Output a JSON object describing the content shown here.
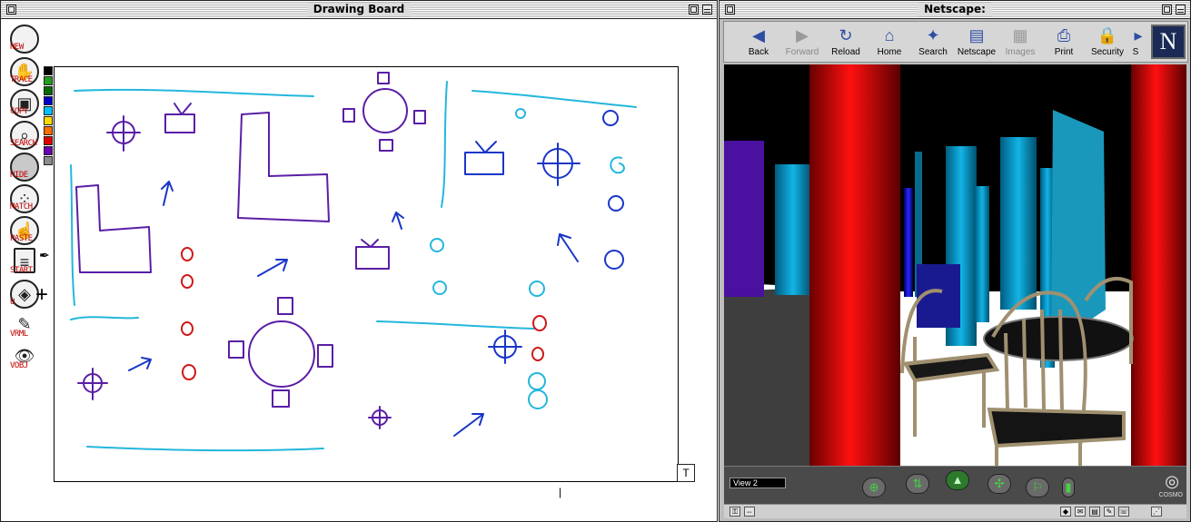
{
  "drawing_window": {
    "title": "Drawing Board",
    "tools": [
      {
        "label": "NEW",
        "icon": "circle-new-icon"
      },
      {
        "label": "TRACE",
        "icon": "cat-paw-icon"
      },
      {
        "label": "COPY",
        "icon": "camera-icon"
      },
      {
        "label": "SEARCH",
        "icon": "magnifier-icon"
      },
      {
        "label": "HIDE",
        "icon": "grey-disc-icon"
      },
      {
        "label": "MATCH",
        "icon": "footprint-icon"
      },
      {
        "label": "PASTE",
        "icon": "hand-icon"
      },
      {
        "label": "START",
        "icon": "page-icon"
      },
      {
        "label": "U",
        "icon": "shapes-icon"
      },
      {
        "label": "VRML",
        "icon": "pencil-icon"
      },
      {
        "label": "VOBJ",
        "icon": "eye-icon"
      }
    ],
    "swatch_colors": [
      "#000000",
      "#1f9e1f",
      "#006b00",
      "#0000cc",
      "#00c0ff",
      "#ffd800",
      "#ff6c00",
      "#e00000",
      "#6b00b0",
      "#8c8c8c"
    ],
    "resize_glyph": "T",
    "ink_colors": {
      "cyan": "#23b7dc",
      "purple": "#5a1ea6",
      "red": "#d01818",
      "blue": "#1a36c8"
    }
  },
  "netscape_window": {
    "title": "Netscape:",
    "toolbar": [
      {
        "label": "Back",
        "icon": "back-arrow-icon",
        "enabled": true
      },
      {
        "label": "Forward",
        "icon": "forward-arrow-icon",
        "enabled": false
      },
      {
        "label": "Reload",
        "icon": "reload-icon",
        "enabled": true
      },
      {
        "label": "Home",
        "icon": "home-icon",
        "enabled": true
      },
      {
        "label": "Search",
        "icon": "search-icon",
        "enabled": true
      },
      {
        "label": "Netscape",
        "icon": "netscape-icon",
        "enabled": true
      },
      {
        "label": "Images",
        "icon": "images-icon",
        "enabled": false
      },
      {
        "label": "Print",
        "icon": "print-icon",
        "enabled": true
      },
      {
        "label": "Security",
        "icon": "lock-icon",
        "enabled": true
      },
      {
        "label": "S",
        "icon": "shop-icon",
        "enabled": true
      }
    ],
    "logo_letter": "N",
    "viewer": {
      "viewpoint": "View 2",
      "brand": "COSMO",
      "accent": "#3fcf3f"
    }
  }
}
